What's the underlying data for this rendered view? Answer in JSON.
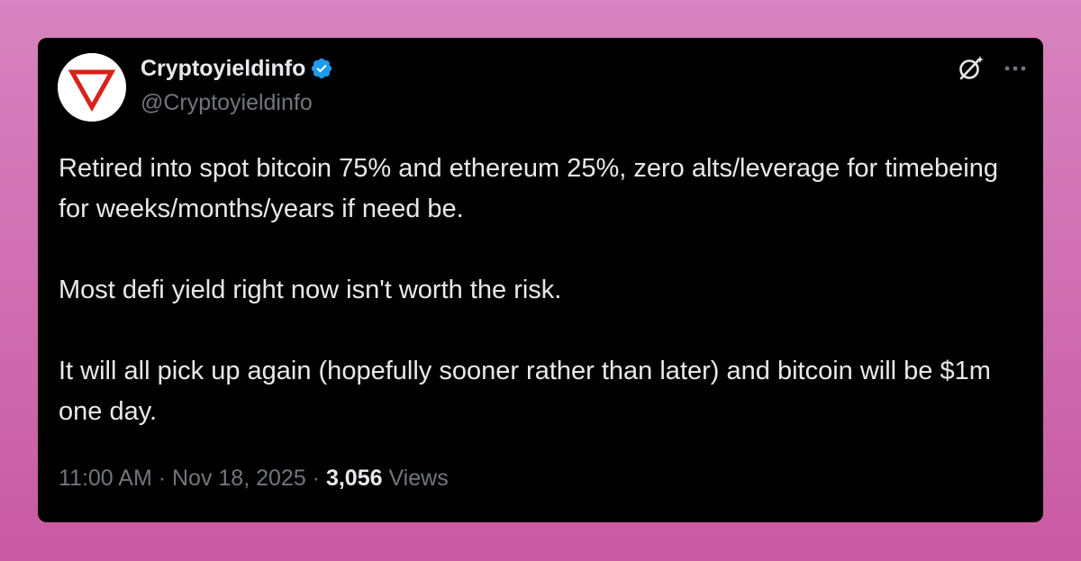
{
  "colors": {
    "page_background_top": "#d783c0",
    "page_background_bottom": "#c95aa2",
    "card_background": "#000000",
    "primary_text": "#e7e9ea",
    "secondary_text": "#71767b",
    "verified_badge": "#1d9bf0",
    "avatar_logo_red": "#d9201a"
  },
  "tweet": {
    "author": {
      "name": "Cryptoyieldinfo",
      "handle": "@Cryptoyieldinfo",
      "verified": true,
      "avatar_icon": "red-inverted-triangle-logo"
    },
    "actions": {
      "grok_icon": "slashed-circle-sparkle-icon",
      "more_icon": "ellipsis-icon"
    },
    "paragraphs": [
      "Retired into spot bitcoin 75% and ethereum 25%, zero alts/leverage for timebeing for weeks/months/years if need be.",
      "Most defi yield right now isn't worth the risk.",
      "It will all pick up again (hopefully sooner rather than later) and bitcoin will be $1m one day."
    ],
    "meta": {
      "time": "11:00 AM",
      "separator": " · ",
      "date": "Nov 18, 2025",
      "views_count": "3,056",
      "views_label": "Views"
    }
  }
}
